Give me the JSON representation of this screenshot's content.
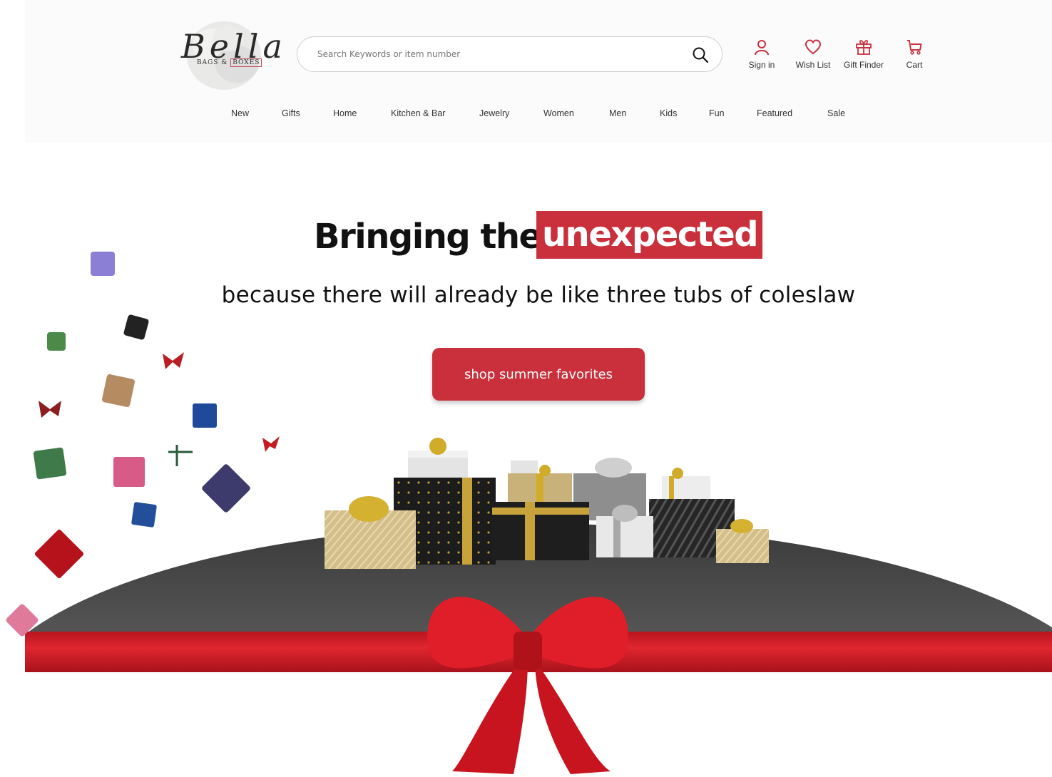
{
  "brand": {
    "script": "Bella",
    "subtitle_left": "BAGS &",
    "subtitle_right": "BOXES"
  },
  "search": {
    "placeholder": "Search Keywords or item number",
    "icon": "search-icon"
  },
  "actions": [
    {
      "label": "Sign in",
      "icon": "user-icon"
    },
    {
      "label": "Wish List",
      "icon": "heart-icon"
    },
    {
      "label": "Gift Finder",
      "icon": "gift-icon"
    },
    {
      "label": "Cart",
      "icon": "cart-icon"
    }
  ],
  "nav": [
    "New",
    "Gifts",
    "Home",
    "Kitchen & Bar",
    "Jewelry",
    "Women",
    "Men",
    "Kids",
    "Fun",
    "Featured",
    "Sale"
  ],
  "hero": {
    "headline_plain": "Bringing the",
    "headline_highlight": "unexpected",
    "subhead": "because there will already be like three tubs of coleslaw",
    "cta": "shop summer favorites"
  },
  "colors": {
    "accent": "#c9303c",
    "icon": "#c9303c",
    "table": "#474747",
    "ribbon": "#d9222e"
  }
}
